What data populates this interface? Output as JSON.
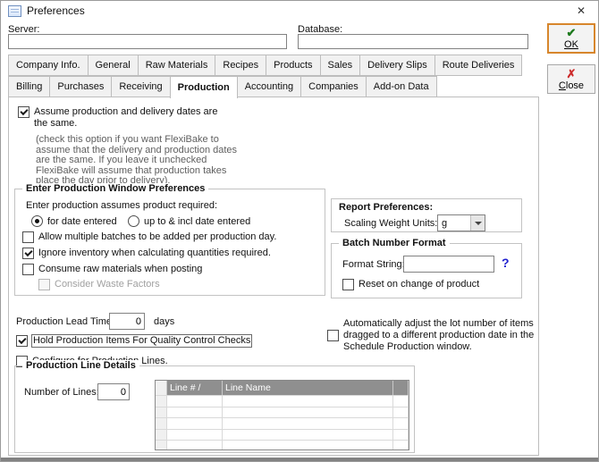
{
  "colors": {
    "ok_border": "#d7862c",
    "ok_check_green": "#1e7a1e",
    "close_x_red": "#cc2a2a",
    "help_question_blue": "#2222d0",
    "table_header_bg": "#8f8f8f"
  },
  "window": {
    "title": "Preferences",
    "close_glyph": "✕"
  },
  "header": {
    "server_label": "Server:",
    "server_value": "",
    "database_label": "Database:",
    "database_value": ""
  },
  "actions": {
    "ok_label": "OK",
    "ok_glyph": "✔",
    "close_label": "Close",
    "close_glyph": "✗"
  },
  "tabs": {
    "active_tab": "Production",
    "row1": [
      "Company Info.",
      "General",
      "Raw Materials",
      "Recipes",
      "Products",
      "Sales",
      "Delivery Slips",
      "Route Deliveries"
    ],
    "row2": [
      "Billing",
      "Purchases",
      "Receiving",
      "Production",
      "Accounting",
      "Companies",
      "Add-on Data"
    ]
  },
  "production_tab": {
    "assume_dates": {
      "label": "Assume production and delivery dates are the same.",
      "checked": true,
      "note": "(check this option if you want FlexiBake to assume that the delivery and production dates are the same. If you leave it unchecked FlexiBake will assume that production takes place the day prior to delivery)."
    },
    "window_prefs": {
      "title": "Enter Production Window Preferences",
      "prompt": "Enter production assumes product required:",
      "radios": [
        {
          "label": "for date entered",
          "selected": true
        },
        {
          "label": "up to & incl date entered",
          "selected": false
        }
      ],
      "checkboxes": [
        {
          "label": "Allow multiple batches to be added per production day.",
          "checked": false
        },
        {
          "label": "Ignore inventory when calculating quantities required.",
          "checked": true
        },
        {
          "label": "Consume raw materials when posting",
          "checked": false
        },
        {
          "label": "Consider Waste Factors",
          "checked": false,
          "disabled": true
        }
      ]
    },
    "report_prefs": {
      "title": "Report Preferences:",
      "scaling_label": "Scaling Weight Units:",
      "scaling_value": "g"
    },
    "batch_format": {
      "title": "Batch Number Format",
      "format_label": "Format String:",
      "format_value": "",
      "help_glyph": "?",
      "reset_checkbox": {
        "label": "Reset on change of product",
        "checked": false
      }
    },
    "lead_time": {
      "label": "Production Lead Time:",
      "value": "0",
      "unit": "days"
    },
    "hold_quality_checkbox": {
      "label": "Hold Production Items For Quality Control Checks",
      "checked": true,
      "focused": true
    },
    "configure_lines_checkbox": {
      "label": "Configure for Production Lines.",
      "checked": false
    },
    "auto_adjust_checkbox": {
      "label": "Automatically adjust the lot number of items dragged to a different production date in the Schedule Production window.",
      "checked": false
    },
    "line_details": {
      "title": "Production Line Details",
      "number_label": "Number of Lines:",
      "number_value": "0",
      "table": {
        "headers": [
          "Line # /",
          "Line Name"
        ],
        "rows": []
      }
    }
  }
}
